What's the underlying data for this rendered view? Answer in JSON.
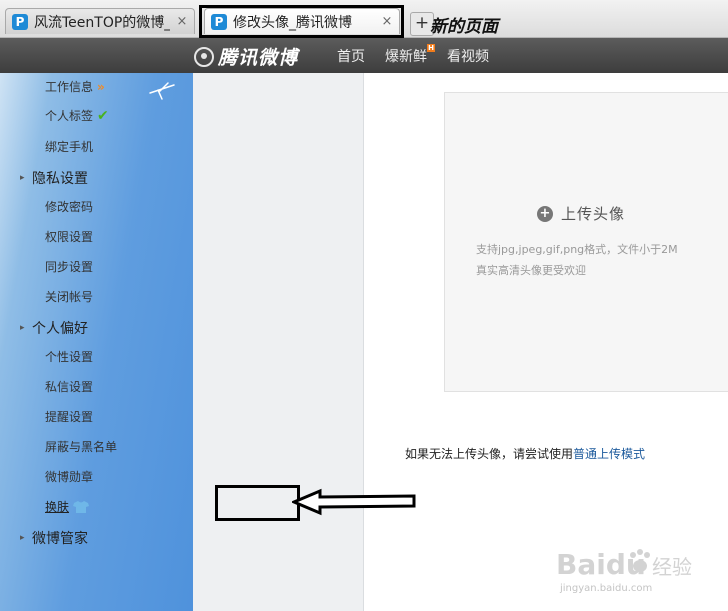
{
  "browser": {
    "tabs": [
      {
        "title": "风流TeenTOP的微博_",
        "close": "×",
        "favicon": "P"
      },
      {
        "title": "修改头像_腾讯微博",
        "close": "×",
        "favicon": "P"
      }
    ],
    "new_tab_symbol": "+",
    "new_tab_annotation": "新的页面"
  },
  "header": {
    "brand": "腾讯微博",
    "nav": [
      "首页",
      "爆新鲜",
      "看视频"
    ],
    "badge": "H"
  },
  "sidebar": {
    "items_top": [
      {
        "label": "工作信息",
        "icon": "double-chevron-right-icon",
        "icon_glyph": "»"
      },
      {
        "label": "个人标签",
        "icon": "checkmark-icon",
        "icon_glyph": "✔"
      },
      {
        "label": "绑定手机"
      }
    ],
    "groups": [
      {
        "label": "隐私设置",
        "items": [
          "修改密码",
          "权限设置",
          "同步设置",
          "关闭帐号"
        ]
      },
      {
        "label": "个人偏好",
        "items": [
          "个性设置",
          "私信设置",
          "提醒设置",
          "屏蔽与黑名单",
          "微博勋章",
          "换肤"
        ]
      },
      {
        "label": "微博管家",
        "items": []
      }
    ],
    "group_arrow": "▸"
  },
  "main": {
    "upload_button": "上传头像",
    "upload_plus": "+",
    "hint_line1": "支持jpg,jpeg,gif,png格式，文件小于2M",
    "hint_line2": "真实高清头像更受欢迎",
    "fallback_text": "如果无法上传头像，请尝试使用",
    "fallback_link": "普通上传模式"
  },
  "watermark": {
    "logo": "Baidu",
    "logo_cn": "经验",
    "url": "jingyan.baidu.com"
  },
  "colors": {
    "header_bg": "#4a4a4a",
    "sidebar_bg": "#eef0f2",
    "sky_blue": "#5f9ddf",
    "link_blue": "#1c5a9c",
    "check_green": "#49b21f",
    "chevron_orange": "#f08a24"
  }
}
